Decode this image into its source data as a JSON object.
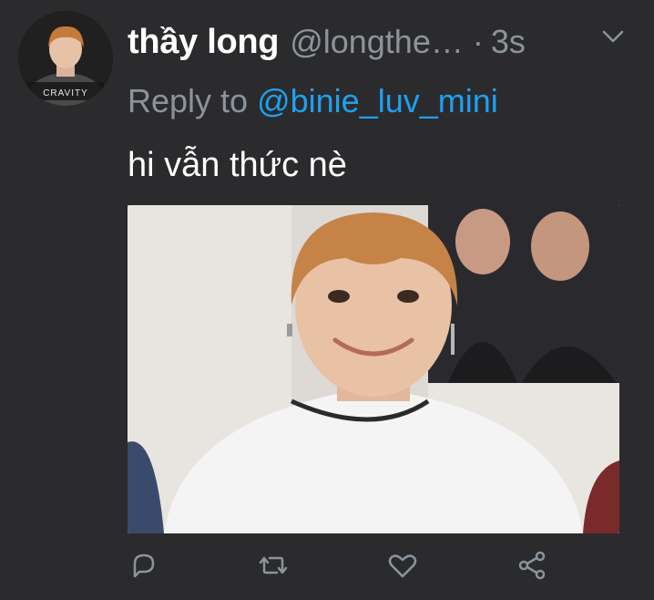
{
  "tweet": {
    "display_name": "thầy long",
    "handle": "@longthe…",
    "separator": "·",
    "time": "3s",
    "reply_prefix": "Reply to",
    "reply_user": "@binie_luv_mini",
    "text": "hi vẫn thức nè",
    "avatar_text": "CRAVITY"
  },
  "icons": {
    "menu": "chevron-down-icon",
    "reply": "reply-icon",
    "retweet": "retweet-icon",
    "like": "heart-icon",
    "share": "share-icon"
  },
  "colors": {
    "background": "#2b2b2d",
    "primary_text": "#ffffff",
    "secondary_text": "#8b949c",
    "link": "#1da1f2",
    "icon": "#8b949c"
  }
}
